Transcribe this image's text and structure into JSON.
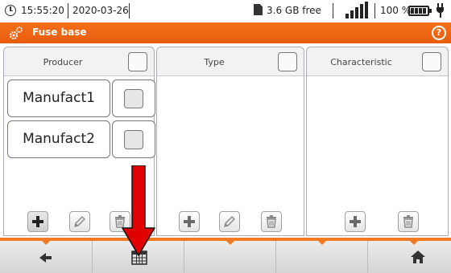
{
  "status": {
    "time": "15:55:20",
    "date": "2020-03-26",
    "storage": "3.6 GB free",
    "battery": "100 %",
    "icons": [
      "clock-icon",
      "sd-card-icon",
      "signal-icon",
      "battery-icon",
      "plug-icon"
    ]
  },
  "titlebar": {
    "title": "Fuse base",
    "icons": [
      "gear-icon",
      "help-icon"
    ],
    "help_symbol": "?"
  },
  "panels": {
    "producer": {
      "header": "Producer",
      "items": [
        {
          "label": "Manufact1"
        },
        {
          "label": "Manufact2"
        }
      ],
      "tools": [
        "add-icon",
        "edit-icon",
        "delete-icon"
      ]
    },
    "type": {
      "header": "Type",
      "items": [],
      "tools": [
        "add-icon",
        "edit-icon",
        "delete-icon"
      ]
    },
    "characteristic": {
      "header": "Characteristic",
      "items": [],
      "tools": [
        "add-icon",
        "delete-icon"
      ]
    }
  },
  "bottombar": {
    "buttons": [
      "back-icon",
      "table-icon",
      "",
      "",
      "home-icon"
    ]
  },
  "annotation": {
    "type": "arrow",
    "color": "#e00000"
  },
  "colors": {
    "accent": "#f07b22",
    "title_bar": "#ee6514",
    "arrow": "#e00000"
  }
}
